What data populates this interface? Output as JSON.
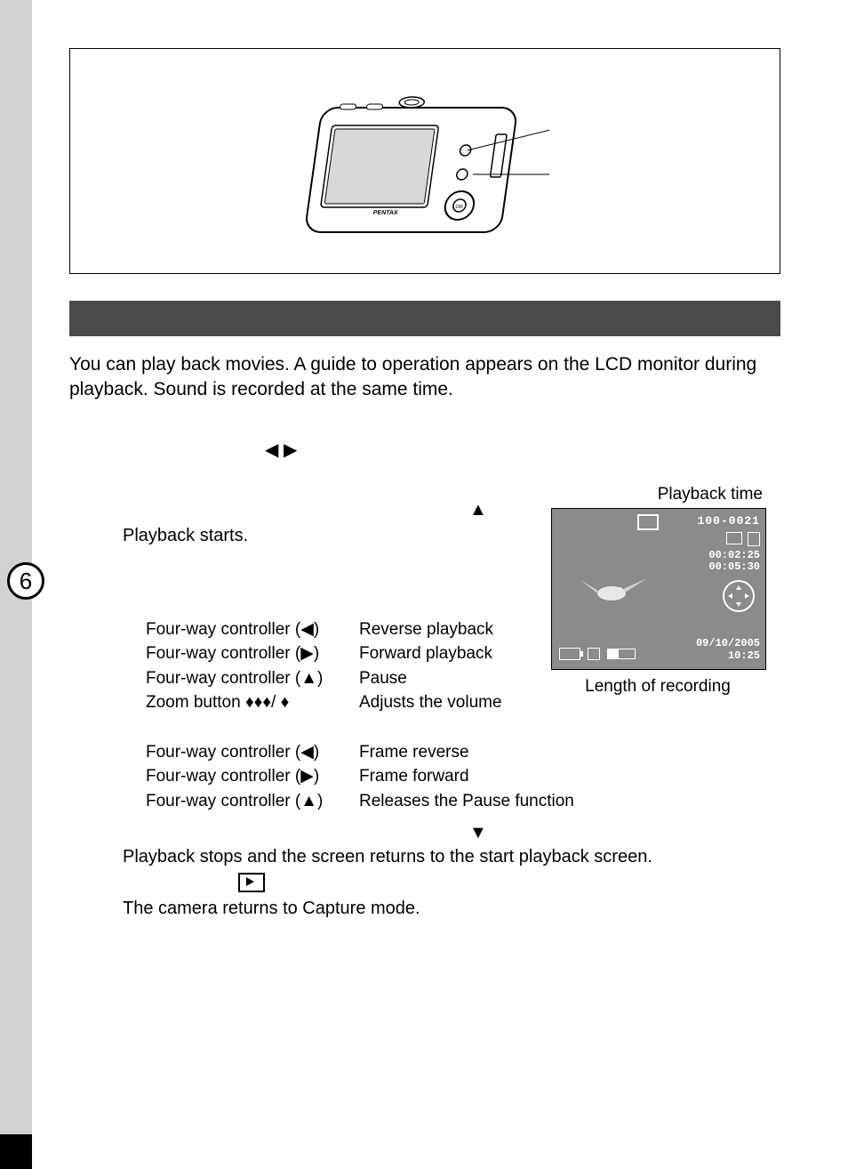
{
  "page_number": "6",
  "intro_text": "You can play back movies. A guide to operation appears on the LCD monitor during playback. Sound is recorded at the same time.",
  "step2": {
    "arrows": "◀ ▶",
    "up_arrow": "▲",
    "result": "Playback starts."
  },
  "ops_play": [
    {
      "ctrl": "Four-way controller (◀)",
      "act": "Reverse playback"
    },
    {
      "ctrl": "Four-way controller (▶)",
      "act": "Forward playback"
    },
    {
      "ctrl": "Four-way controller (▲)",
      "act": "Pause"
    },
    {
      "ctrl": "Zoom button ♦♦♦/ ♦",
      "act": "Adjusts the volume"
    }
  ],
  "ops_pause": [
    {
      "ctrl": "Four-way controller (◀)",
      "act": "Frame reverse"
    },
    {
      "ctrl": "Four-way controller (▶)",
      "act": "Frame forward"
    },
    {
      "ctrl": "Four-way controller (▲)",
      "act": "Releases the Pause function"
    }
  ],
  "step4": {
    "down_arrow": "▼",
    "result": "Playback stops and the screen returns to the start playback screen."
  },
  "step5": {
    "result": "The camera returns to Capture mode."
  },
  "lcd": {
    "label_top": "Playback time",
    "file_no": "100-0021",
    "elapsed": "00:02:25",
    "total": "00:05:30",
    "date": "09/10/2005",
    "time": "10:25",
    "caption_bottom": "Length of recording"
  },
  "camera_brand": "PENTAX"
}
